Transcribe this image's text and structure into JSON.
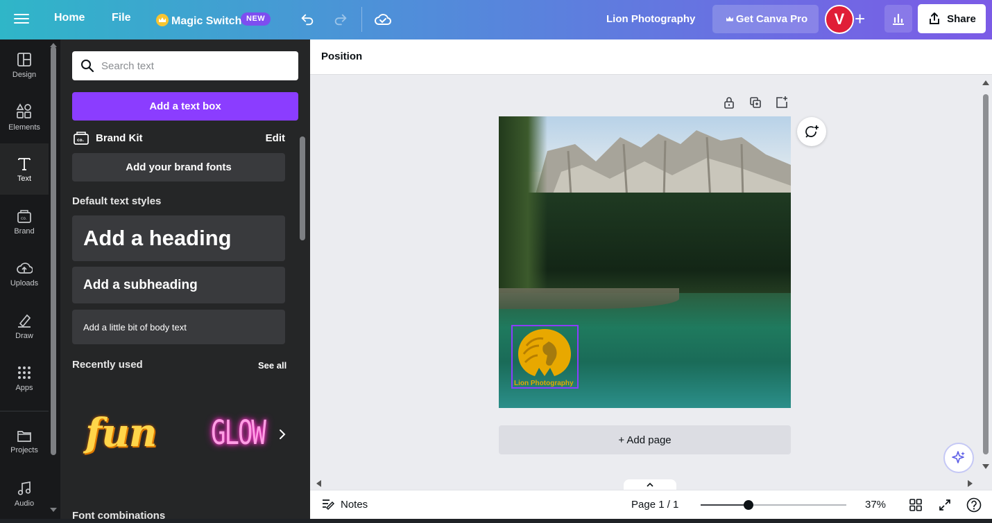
{
  "topbar": {
    "home": "Home",
    "file": "File",
    "magic_switch": "Magic Switch",
    "new_badge": "NEW",
    "design_title": "Lion Photography",
    "get_pro": "Get Canva Pro",
    "avatar_initial": "V",
    "share": "Share"
  },
  "rail": {
    "items": [
      {
        "label": "Design",
        "icon": "layout-icon"
      },
      {
        "label": "Elements",
        "icon": "shapes-icon"
      },
      {
        "label": "Text",
        "icon": "text-icon"
      },
      {
        "label": "Brand",
        "icon": "brand-icon"
      },
      {
        "label": "Uploads",
        "icon": "cloud-upload-icon"
      },
      {
        "label": "Draw",
        "icon": "pen-icon"
      },
      {
        "label": "Apps",
        "icon": "grid-icon"
      },
      {
        "label": "Projects",
        "icon": "folder-icon"
      },
      {
        "label": "Audio",
        "icon": "music-icon"
      }
    ],
    "active": "Text"
  },
  "panel": {
    "search_placeholder": "Search text",
    "add_textbox": "Add a text box",
    "brand_kit": "Brand Kit",
    "brand_kit_edit": "Edit",
    "add_brand_fonts": "Add your brand fonts",
    "default_styles_title": "Default text styles",
    "heading": "Add a heading",
    "subheading": "Add a subheading",
    "body": "Add a little bit of body text",
    "recently_used": "Recently used",
    "see_all": "See all",
    "recent_fun": "fun",
    "recent_glow": "GLOW",
    "font_combinations": "Font combinations"
  },
  "contextbar": {
    "position": "Position"
  },
  "canvas": {
    "logo_caption": "Lion Photography",
    "add_page": "+ Add page",
    "accent": "#8b3dff"
  },
  "bottombar": {
    "notes": "Notes",
    "page_indicator": "Page 1 / 1",
    "zoom_percent": "37%",
    "zoom_fraction": 0.33
  }
}
